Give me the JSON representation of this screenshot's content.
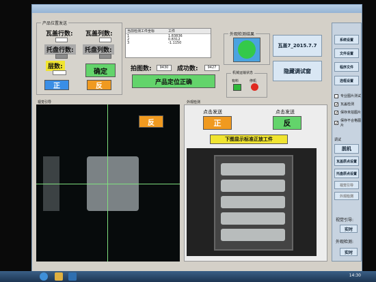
{
  "window_title": "",
  "product_panel": {
    "label": "产品位置发送",
    "rows_a": "瓦盖行数:",
    "cols_a": "瓦盖列数:",
    "rows_b": "托盘行数:",
    "cols_b": "托盘列数:",
    "layers": "层数:",
    "confirm": "确定",
    "front": "正",
    "back": "反"
  },
  "table": {
    "headers": [
      "当前检测工件坐标",
      "工件"
    ],
    "rows": [
      [
        "1",
        "1.83836"
      ],
      [
        "2",
        "0.8312"
      ],
      [
        "3",
        "-1.1150"
      ]
    ]
  },
  "shot_count_label": "拍图数:",
  "shot_count": "9430",
  "success_label": "成功数:",
  "success_count": "9427",
  "position_ok": "产品定位正确",
  "detect_panel_label": "外观检测结果",
  "date_box": "瓦盖7_2015.7.7",
  "hide_debug": "隐藏调试窗",
  "robot_panel_label": "机械运输状态",
  "robot_light1": "有料",
  "robot_light2": "停机",
  "right_buttons": [
    "系统设置",
    "文件设置",
    "程序文件",
    "选框设置"
  ],
  "checkboxes": [
    {
      "label": "专业图片测试",
      "checked": false
    },
    {
      "label": "瓦盖检测",
      "checked": true
    },
    {
      "label": "保存未拍图片",
      "checked": true
    },
    {
      "label": "保存不合格图片",
      "checked": true
    }
  ],
  "right_lower_label": "调试",
  "right_lower_buttons": [
    "脱机",
    "瓦盖原点设置",
    "托盘原点设置",
    "视觉引导",
    "外观检测"
  ],
  "sub_label": "视觉引导:",
  "sub_btn": "实时",
  "sub_label2": "外观检测:",
  "sub_btn2": "实时",
  "left_cam_label": "视觉引导",
  "left_cam_badge": "反",
  "right_cam_label": "外观检测",
  "click_send_1": "点击发送",
  "click_send_2": "点击发送",
  "front_btn": "正",
  "back_btn": "反",
  "std_caption": "下图显示标准正放工件",
  "clock": "14:30"
}
